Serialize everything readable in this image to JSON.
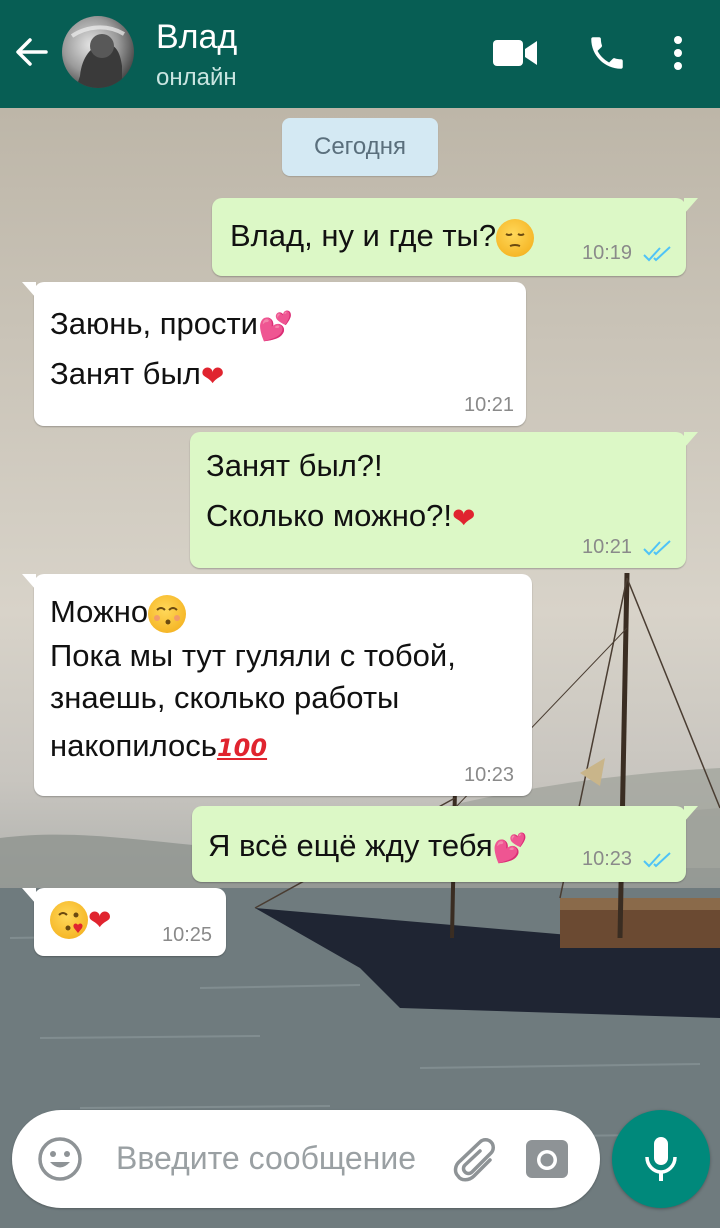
{
  "header": {
    "contact_name": "Влад",
    "status": "онлайн"
  },
  "icons": {
    "back": "arrow-left-icon",
    "video": "video-camera-icon",
    "call": "phone-icon",
    "menu": "more-vert-icon",
    "emoji": "emoji-smile-icon",
    "attach": "paperclip-icon",
    "camera": "camera-icon",
    "mic": "microphone-icon"
  },
  "date_chip": "Сегодня",
  "messages": [
    {
      "direction": "out",
      "lines": [
        "Влад, ну и где ты?"
      ],
      "emoji": [
        "pensive"
      ],
      "time": "10:19",
      "read": true
    },
    {
      "direction": "in",
      "lines": [
        "Заюнь, прости",
        "Занят был"
      ],
      "emoji": [
        "sparkling-heart",
        "red-heart"
      ],
      "time": "10:21"
    },
    {
      "direction": "out",
      "lines": [
        "Занят был?!",
        "Сколько можно?!"
      ],
      "emoji": [
        "red-heart"
      ],
      "time": "10:21",
      "read": true
    },
    {
      "direction": "in",
      "lines": [
        "Можно",
        "Пока мы тут гуляли с тобой,",
        "знаешь, сколько работы",
        "накопилось"
      ],
      "emoji": [
        "kissing-smiling-eyes",
        "hundred-points"
      ],
      "time": "10:23"
    },
    {
      "direction": "out",
      "lines": [
        "Я всё ещё жду тебя"
      ],
      "emoji": [
        "sparkling-heart"
      ],
      "time": "10:23",
      "read": true
    },
    {
      "direction": "in",
      "lines": [
        ""
      ],
      "emoji": [
        "face-blowing-kiss",
        "red-heart"
      ],
      "time": "10:25"
    }
  ],
  "input": {
    "placeholder": "Введите сообщение"
  },
  "colors": {
    "header": "#075e54",
    "outgoing_bubble": "#dcf8c6",
    "incoming_bubble": "#ffffff",
    "read_ticks": "#4fc3f7",
    "mic_button": "#00897b",
    "date_chip": "#d4e9f3"
  }
}
